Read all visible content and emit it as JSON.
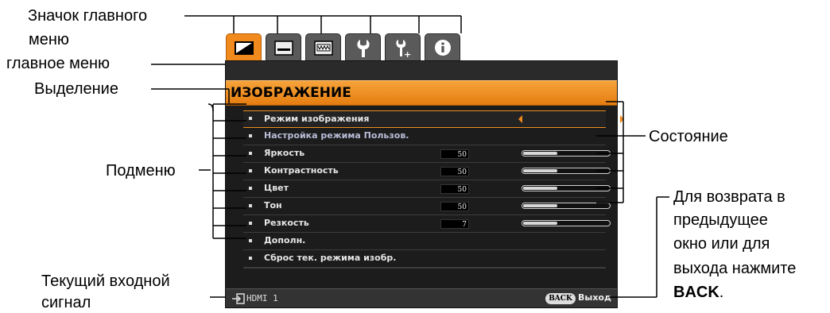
{
  "annotations": {
    "main_menu_icon": [
      "Значок главного",
      "меню"
    ],
    "main_menu": "главное меню",
    "highlight": "Выделение",
    "submenu": "Подменю",
    "status": "Состояние",
    "back_hint": [
      "Для возврата в",
      "предыдущее",
      "окно или для",
      "выхода нажмите"
    ],
    "back_key": "BACK",
    "back_period": ".",
    "current_input": [
      "Текущий входной",
      "сигнал"
    ]
  },
  "tabs": [
    {
      "icon": "picture-icon",
      "active": true
    },
    {
      "icon": "display-icon",
      "active": false
    },
    {
      "icon": "wall-color-icon",
      "active": false
    },
    {
      "icon": "wrench-icon",
      "active": false
    },
    {
      "icon": "advanced-wrench-icon",
      "active": false
    },
    {
      "icon": "info-icon",
      "active": false
    }
  ],
  "menu": {
    "title": "ИЗОБРАЖЕНИЕ",
    "items": [
      {
        "label": "Режим изображения",
        "selected": true,
        "value": null,
        "level": null
      },
      {
        "label": "Настройка режима Пользов.",
        "dim": true,
        "value": null,
        "level": null
      },
      {
        "label": "Яркость",
        "value": "50",
        "level": 0.4
      },
      {
        "label": "Контрастность",
        "value": "50",
        "level": 0.4
      },
      {
        "label": "Цвет",
        "value": "50",
        "level": 0.4
      },
      {
        "label": "Тон",
        "value": "50",
        "level": 0.4
      },
      {
        "label": "Резкость",
        "value": "7",
        "level": 0.4
      },
      {
        "label": "Дополн.",
        "value": null,
        "level": null
      },
      {
        "label": "Сброс тек. режима изобр.",
        "value": null,
        "level": null
      }
    ],
    "input_source": "HDMI 1",
    "back_button": "BACK",
    "exit_label": "Выход"
  },
  "colors": {
    "accent": "#f08a1c",
    "menu_bg": "#1c1c1c"
  }
}
